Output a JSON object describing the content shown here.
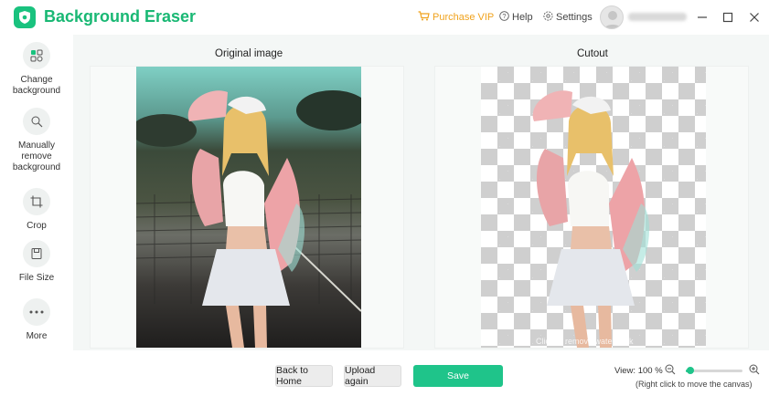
{
  "app": {
    "title": "Background Eraser",
    "accent": "#19c27e"
  },
  "header": {
    "purchase_vip": "Purchase VIP",
    "help": "Help",
    "settings": "Settings"
  },
  "sidebar": {
    "items": [
      {
        "label": "Change\nbackground",
        "icon": "change-background-icon"
      },
      {
        "label": "Manually\nremove\nbackground",
        "icon": "manual-remove-icon"
      },
      {
        "label": "Crop",
        "icon": "crop-icon"
      },
      {
        "label": "File Size",
        "icon": "file-size-icon"
      },
      {
        "label": "More",
        "icon": "more-icon"
      }
    ]
  },
  "main": {
    "original_title": "Original image",
    "cutout_title": "Cutout",
    "watermark": "Click to remove watermark"
  },
  "footer": {
    "back_home": "Back to Home",
    "upload_again": "Upload again",
    "save": "Save",
    "view_label": "View: 100 %",
    "zoom_percent": 100,
    "slider_level": 0.08,
    "hint": "(Right click to move the canvas)"
  }
}
